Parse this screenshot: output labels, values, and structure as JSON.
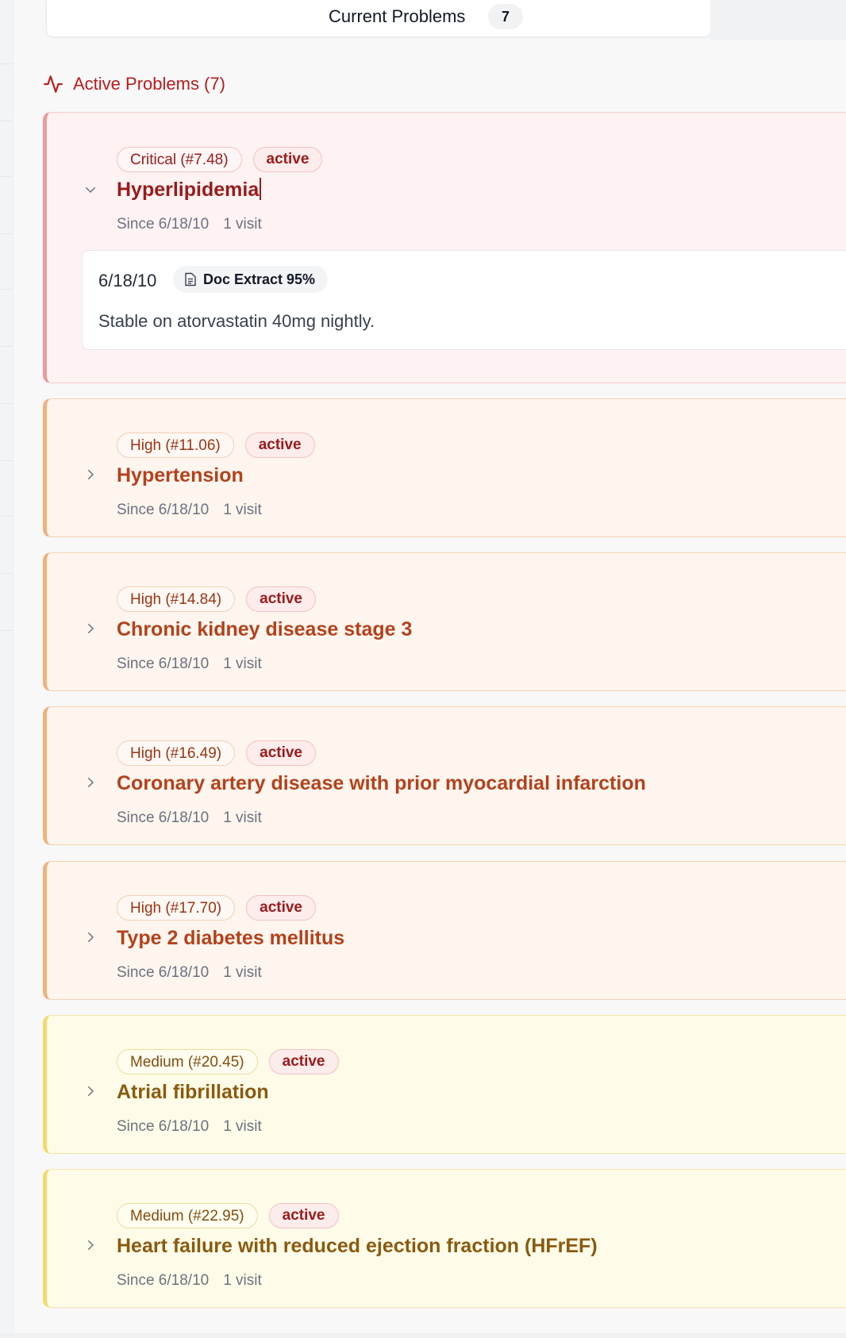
{
  "header": {
    "title": "Current Problems",
    "count": "7"
  },
  "section": {
    "title": "Active Problems (7)"
  },
  "colors": {
    "critical": "#991b1b",
    "high": "#b3421c",
    "medium": "#8a5a10",
    "active_badge": "#991b1b"
  },
  "problems": [
    {
      "severity": "Critical (#7.48)",
      "status": "active",
      "title": "Hyperlipidemia",
      "since": "Since 6/18/10",
      "visits": "1 visit",
      "expanded": true,
      "entry": {
        "date": "6/18/10",
        "source": "Doc Extract 95%",
        "source_icon": "document-icon",
        "note": "Stable on atorvastatin 40mg nightly."
      }
    },
    {
      "severity": "High (#11.06)",
      "status": "active",
      "title": "Hypertension",
      "since": "Since 6/18/10",
      "visits": "1 visit",
      "expanded": false
    },
    {
      "severity": "High (#14.84)",
      "status": "active",
      "title": "Chronic kidney disease stage 3",
      "since": "Since 6/18/10",
      "visits": "1 visit",
      "expanded": false
    },
    {
      "severity": "High (#16.49)",
      "status": "active",
      "title": "Coronary artery disease with prior myocardial infarction",
      "since": "Since 6/18/10",
      "visits": "1 visit",
      "expanded": false
    },
    {
      "severity": "High (#17.70)",
      "status": "active",
      "title": "Type 2 diabetes mellitus",
      "since": "Since 6/18/10",
      "visits": "1 visit",
      "expanded": false
    },
    {
      "severity": "Medium (#20.45)",
      "status": "active",
      "title": "Atrial fibrillation",
      "since": "Since 6/18/10",
      "visits": "1 visit",
      "expanded": false
    },
    {
      "severity": "Medium (#22.95)",
      "status": "active",
      "title": "Heart failure with reduced ejection fraction (HFrEF)",
      "since": "Since 6/18/10",
      "visits": "1 visit",
      "expanded": false
    }
  ]
}
